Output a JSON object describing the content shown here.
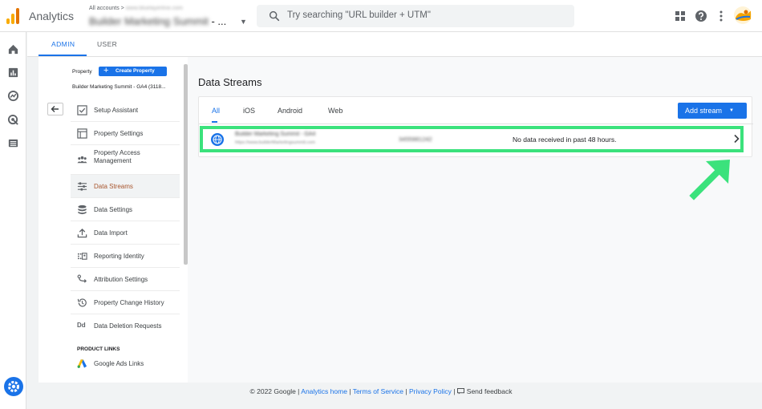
{
  "topbar": {
    "app_title": "Analytics",
    "account_breadcrumb_prefix": "All accounts >",
    "account_breadcrumb_blurred": "www.bluelayerline.com",
    "property_name_blurred": "Builder Marketing Summit",
    "property_name_suffix": " - ...",
    "search_placeholder": "Try searching \"URL builder + UTM\""
  },
  "icons": {
    "apps": "apps-grid-icon",
    "help": "help-icon",
    "more": "more-vert-icon",
    "search": "search-icon"
  },
  "admin_tabs": [
    {
      "label": "ADMIN",
      "active": true
    },
    {
      "label": "USER",
      "active": false
    }
  ],
  "property_column": {
    "label": "Property",
    "create_button": "Create Property",
    "property_subtitle": "Builder Marketing Summit - GA4 (3118...",
    "menu": [
      {
        "label": "Setup Assistant",
        "icon": "checkbox-icon"
      },
      {
        "label": "Property Settings",
        "icon": "settings-panel-icon"
      },
      {
        "label": "Property Access\nManagement",
        "icon": "people-icon"
      },
      {
        "label": "Data Streams",
        "icon": "streams-icon",
        "active": true
      },
      {
        "label": "Data Settings",
        "icon": "database-icon"
      },
      {
        "label": "Data Import",
        "icon": "upload-icon"
      },
      {
        "label": "Reporting Identity",
        "icon": "identity-icon"
      },
      {
        "label": "Attribution Settings",
        "icon": "attribution-icon"
      },
      {
        "label": "Property Change History",
        "icon": "history-icon"
      },
      {
        "label": "Data Deletion Requests",
        "icon": "dd-icon"
      }
    ],
    "product_links_heading": "PRODUCT LINKS",
    "product_links": [
      {
        "label": "Google Ads Links",
        "icon": "google-ads-icon"
      }
    ]
  },
  "data_streams": {
    "title": "Data Streams",
    "tabs": [
      "All",
      "iOS",
      "Android",
      "Web"
    ],
    "active_tab": "All",
    "add_stream_label": "Add stream",
    "streams": [
      {
        "name_blurred": "Builder Marketing Summit - GA4",
        "url_blurred": "https://www.builderMarketingsummit.com",
        "id_blurred": "3455981242",
        "status": "No data received in past 48 hours."
      }
    ]
  },
  "footer": {
    "copyright": "© 2022 Google",
    "sep": " | ",
    "links": [
      "Analytics home",
      "Terms of Service",
      "Privacy Policy"
    ],
    "feedback": "Send feedback"
  },
  "colors": {
    "accent": "#1a73e8",
    "highlight": "#3be27c",
    "active_menu_text": "#a8552d"
  }
}
